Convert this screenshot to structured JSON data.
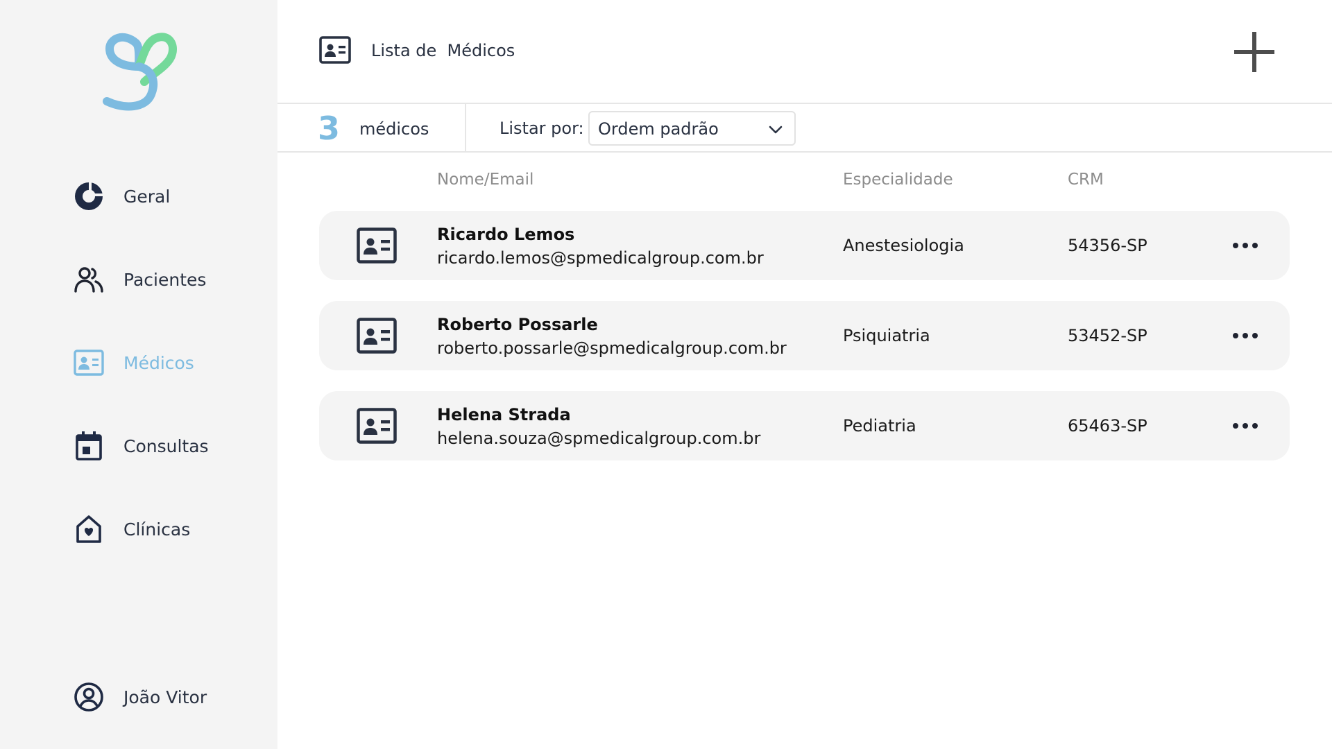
{
  "sidebar": {
    "logo_icon": "heart-s-logo",
    "items": [
      {
        "label": "Geral",
        "icon": "donut-chart-icon",
        "active": false
      },
      {
        "label": "Pacientes",
        "icon": "users-icon",
        "active": false
      },
      {
        "label": "Médicos",
        "icon": "id-card-icon",
        "active": true
      },
      {
        "label": "Consultas",
        "icon": "calendar-icon",
        "active": false
      },
      {
        "label": "Clínicas",
        "icon": "house-heart-icon",
        "active": false
      }
    ],
    "user": {
      "label": "João Vitor",
      "icon": "user-circle-icon"
    }
  },
  "header": {
    "title": "Lista de  Médicos",
    "title_icon": "id-card-icon",
    "add_icon": "plus-icon"
  },
  "filter": {
    "count": "3",
    "count_label": "médicos",
    "sort_label": "Listar por:",
    "sort_value": "Ordem padrão"
  },
  "table": {
    "headers": {
      "name_email": "Nome/Email",
      "specialty": "Especialidade",
      "crm": "CRM"
    },
    "rows": [
      {
        "name": "Ricardo Lemos",
        "email": "ricardo.lemos@spmedicalgroup.com.br",
        "specialty": "Anestesiologia",
        "crm": "54356-SP"
      },
      {
        "name": "Roberto Possarle",
        "email": "roberto.possarle@spmedicalgroup.com.br",
        "specialty": "Psiquiatria",
        "crm": "53452-SP"
      },
      {
        "name": "Helena Strada",
        "email": "helena.souza@spmedicalgroup.com.br",
        "specialty": "Pediatria",
        "crm": "65463-SP"
      }
    ]
  },
  "colors": {
    "accent": "#7dbbe0",
    "logo_green": "#74d99a",
    "dark": "#2a3242",
    "sidebar_bg": "#f4f4f4",
    "row_bg": "#f4f4f4"
  }
}
